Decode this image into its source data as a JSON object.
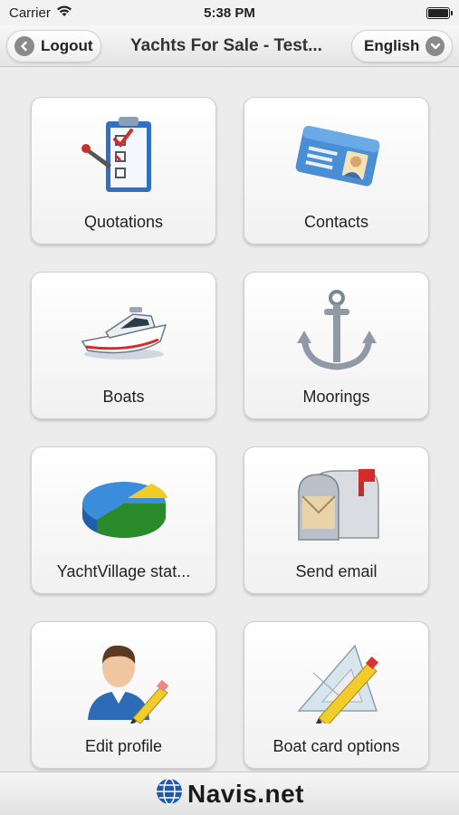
{
  "status_bar": {
    "carrier": "Carrier",
    "time": "5:38 PM",
    "icons": [
      "wifi-icon",
      "battery-icon"
    ]
  },
  "nav": {
    "logout_label": "Logout",
    "title": "Yachts For Sale - Test...",
    "language_label": "English"
  },
  "tiles": [
    {
      "label": "Quotations",
      "icon": "clipboard-checklist-icon"
    },
    {
      "label": "Contacts",
      "icon": "identity-card-icon"
    },
    {
      "label": "Boats",
      "icon": "motor-yacht-icon"
    },
    {
      "label": "Moorings",
      "icon": "anchor-icon"
    },
    {
      "label": "YachtVillage stat...",
      "icon": "pie-chart-icon"
    },
    {
      "label": "Send email",
      "icon": "mailbox-icon"
    },
    {
      "label": "Edit profile",
      "icon": "user-pencil-icon"
    },
    {
      "label": "Boat card options",
      "icon": "set-square-pencil-icon"
    }
  ],
  "footer": {
    "logo_text": "Navis.net"
  },
  "colors": {
    "background": "#ececec",
    "tile_border": "#cfcfcf",
    "accent_red": "#d62b2b",
    "chart_blue": "#2f7fd0",
    "chart_green": "#3aa83a",
    "chart_yellow": "#f1cc2a"
  }
}
